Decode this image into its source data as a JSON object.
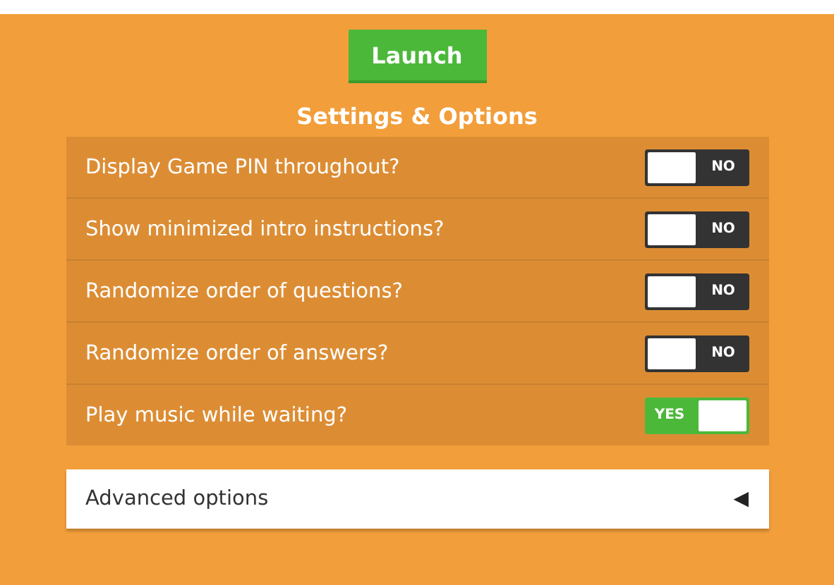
{
  "launch_button": {
    "label": "Launch"
  },
  "heading": "Settings & Options",
  "settings": [
    {
      "label": "Display Game PIN throughout?",
      "on": false,
      "state_text": "NO"
    },
    {
      "label": "Show minimized intro instructions?",
      "on": false,
      "state_text": "NO"
    },
    {
      "label": "Randomize order of questions?",
      "on": false,
      "state_text": "NO"
    },
    {
      "label": "Randomize order of answers?",
      "on": false,
      "state_text": "NO"
    },
    {
      "label": "Play music while waiting?",
      "on": true,
      "state_text": "YES"
    }
  ],
  "advanced": {
    "label": "Advanced options",
    "expanded": false,
    "arrow": "◀"
  }
}
